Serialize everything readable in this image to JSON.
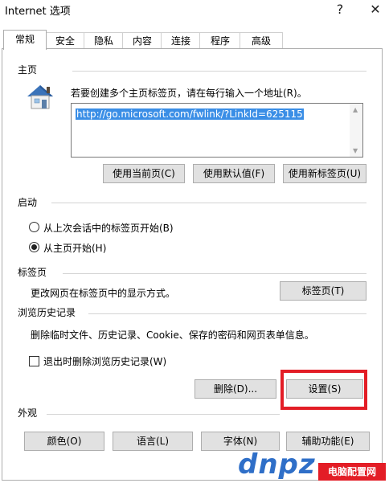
{
  "window": {
    "title": "Internet 选项",
    "help_glyph": "?",
    "close_glyph": "✕"
  },
  "tabs": [
    {
      "label": "常规",
      "active": true
    },
    {
      "label": "安全"
    },
    {
      "label": "隐私"
    },
    {
      "label": "内容"
    },
    {
      "label": "连接"
    },
    {
      "label": "程序"
    },
    {
      "label": "高级"
    }
  ],
  "homepage": {
    "heading": "主页",
    "instruction": "若要创建多个主页标签页，请在每行输入一个地址(R)。",
    "url": "http://go.microsoft.com/fwlink/?LinkId=625115",
    "btn_current": "使用当前页(C)",
    "btn_default": "使用默认值(F)",
    "btn_newtab": "使用新标签页(U)"
  },
  "startup": {
    "heading": "启动",
    "option_last_session": "从上次会话中的标签页开始(B)",
    "option_homepage": "从主页开始(H)",
    "selected": "homepage"
  },
  "tabs_section": {
    "heading": "标签页",
    "desc": "更改网页在标签页中的显示方式。",
    "btn_tabs": "标签页(T)"
  },
  "history": {
    "heading": "浏览历史记录",
    "desc": "删除临时文件、历史记录、Cookie、保存的密码和网页表单信息。",
    "checkbox_label": "退出时删除浏览历史记录(W)",
    "checked": false,
    "btn_delete": "删除(D)...",
    "btn_settings": "设置(S)"
  },
  "appearance": {
    "heading": "外观",
    "btn_colors": "颜色(O)",
    "btn_languages": "语言(L)",
    "btn_fonts": "字体(N)",
    "btn_accessibility": "辅助功能(E)"
  },
  "watermark": {
    "logo": "dnpz",
    "site": "电脑配置网"
  },
  "colors": {
    "accent_highlight": "#e31d26",
    "selection": "#3a8ee6"
  },
  "icons": {
    "homepage": "house-icon"
  }
}
